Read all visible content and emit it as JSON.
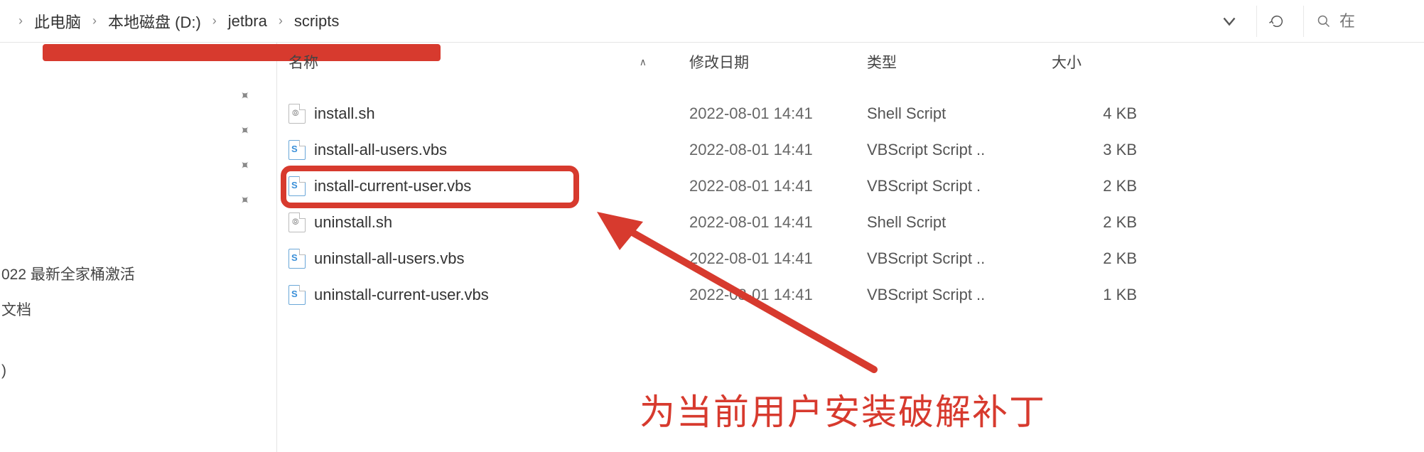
{
  "address": {
    "crumbs": [
      "此电脑",
      "本地磁盘 (D:)",
      "jetbra",
      "scripts"
    ],
    "search_placeholder": "在"
  },
  "sidebar": {
    "items": [
      "022 最新全家桶激活",
      "文档",
      ")"
    ]
  },
  "columns": {
    "name": "名称",
    "date": "修改日期",
    "type": "类型",
    "size": "大小"
  },
  "files": [
    {
      "name": "install.sh",
      "date": "2022-08-01 14:41",
      "type": "Shell Script",
      "size": "4 KB",
      "icon": "sh",
      "highlight": false
    },
    {
      "name": "install-all-users.vbs",
      "date": "2022-08-01 14:41",
      "type": "VBScript Script ..",
      "size": "3 KB",
      "icon": "vbs",
      "highlight": false
    },
    {
      "name": "install-current-user.vbs",
      "date": "2022-08-01 14:41",
      "type": "VBScript Script .",
      "size": "2 KB",
      "icon": "vbs",
      "highlight": true
    },
    {
      "name": "uninstall.sh",
      "date": "2022-08-01 14:41",
      "type": "Shell Script",
      "size": "2 KB",
      "icon": "sh",
      "highlight": false
    },
    {
      "name": "uninstall-all-users.vbs",
      "date": "2022-08-01 14:41",
      "type": "VBScript Script ..",
      "size": "2 KB",
      "icon": "vbs",
      "highlight": false
    },
    {
      "name": "uninstall-current-user.vbs",
      "date": "2022-08-01 14:41",
      "type": "VBScript Script ..",
      "size": "1 KB",
      "icon": "vbs",
      "highlight": false
    }
  ],
  "annotation": "为当前用户安装破解补丁"
}
